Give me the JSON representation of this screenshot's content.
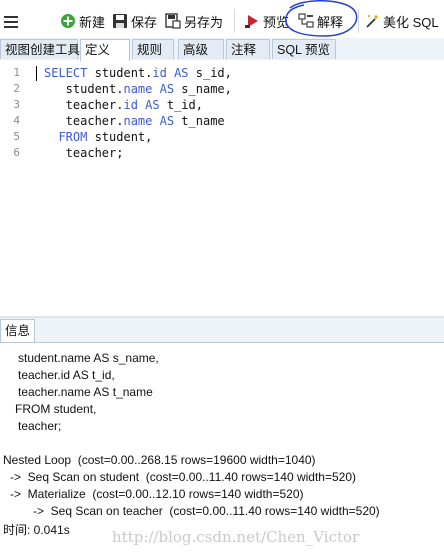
{
  "toolbar": {
    "new_label": "新建",
    "save_label": "保存",
    "save_as_label": "另存为",
    "preview_label": "预览",
    "explain_label": "解释",
    "beautify_label": "美化 SQL"
  },
  "tabs": [
    {
      "label": "视图创建工具"
    },
    {
      "label": "定义"
    },
    {
      "label": "规则"
    },
    {
      "label": "高级"
    },
    {
      "label": "注释"
    },
    {
      "label": "SQL 预览"
    }
  ],
  "editor": {
    "line_numbers": [
      "1",
      "2",
      "3",
      "4",
      "5",
      "6"
    ],
    "lines": [
      "SELECT student.id AS s_id,",
      "   student.name AS s_name,",
      "   teacher.id AS t_id,",
      "   teacher.name AS t_name",
      "  FROM student,",
      "   teacher;"
    ]
  },
  "info_panel": {
    "tab_label": "信息",
    "query_echo": [
      "student.name AS s_name,",
      "teacher.id AS t_id,",
      "teacher.name AS t_name",
      "FROM student,",
      "teacher;"
    ],
    "plan": [
      "Nested Loop  (cost=0.00..268.15 rows=19600 width=1040)",
      "->  Seq Scan on student  (cost=0.00..11.40 rows=140 width=520)",
      "->  Materialize  (cost=0.00..12.10 rows=140 width=520)",
      "->  Seq Scan on teacher  (cost=0.00..11.40 rows=140 width=520)"
    ],
    "time_label": "时间: 0.041s"
  },
  "watermark": "http://blog.csdn.net/Chen_Victor",
  "colors": {
    "keyword": "#3b5bdb",
    "tab_border": "#b9c9dc",
    "annotation_circle": "#1f3fd6"
  },
  "icons": [
    "menu-icon",
    "new-icon",
    "save-icon",
    "save-as-icon",
    "preview-icon",
    "explain-icon",
    "beautify-icon"
  ]
}
